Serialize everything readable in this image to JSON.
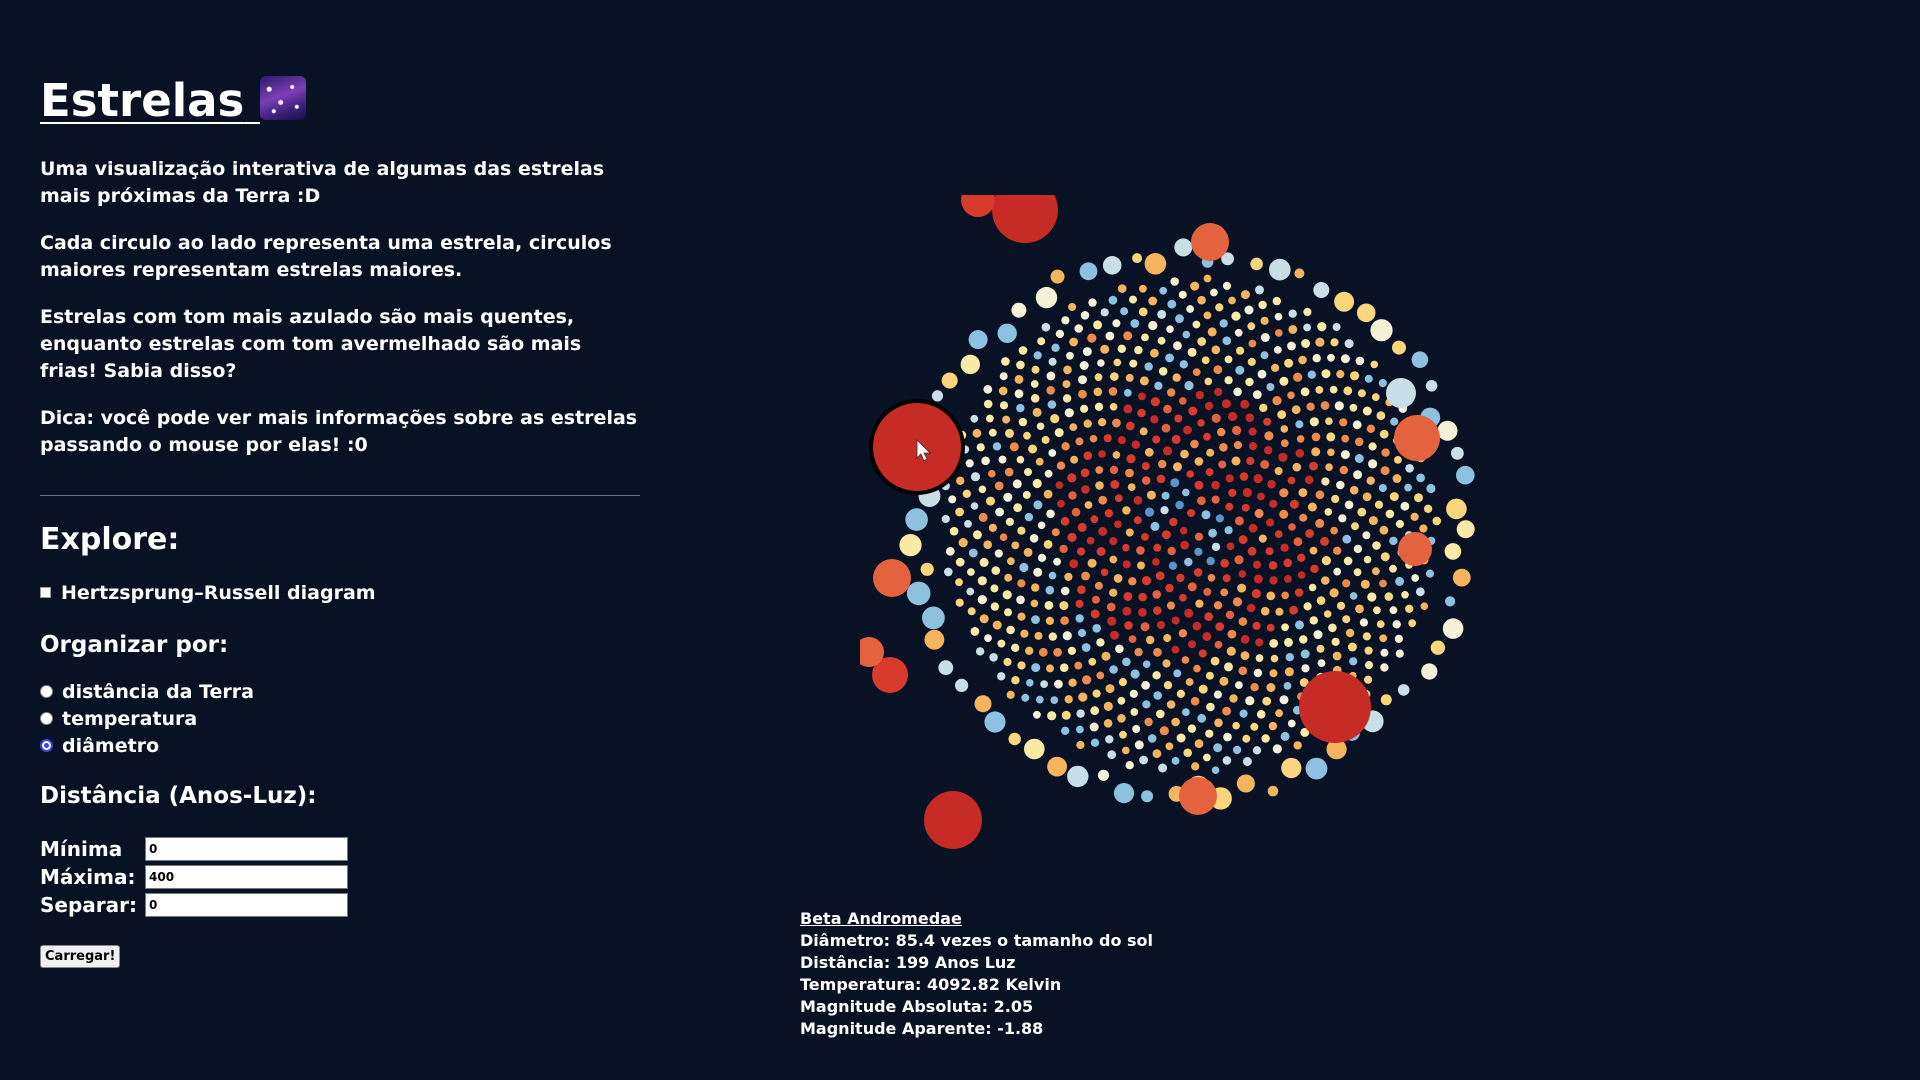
{
  "header": {
    "title": "Estrelas",
    "title_icon": "milky-way-icon"
  },
  "intro": {
    "p1": "Uma visualização interativa de algumas das estrelas mais próximas da Terra :D",
    "p2": "Cada circulo ao lado representa uma estrela, circulos maiores representam estrelas maiores.",
    "p3": "Estrelas com tom mais azulado são mais quentes, enquanto estrelas com tom avermelhado são mais frias! Sabia disso?",
    "p4": "Dica: você pode ver mais informações sobre as estrelas passando o mouse por elas! :0"
  },
  "explore": {
    "heading": "Explore:",
    "hr_label": "Hertzsprung–Russell diagram",
    "hr_checked": false
  },
  "organize": {
    "heading": "Organizar por:",
    "options": [
      "distância da Terra",
      "temperatura",
      "diâmetro"
    ],
    "selected": "diâmetro"
  },
  "distance": {
    "heading": "Distância (Anos-Luz):",
    "min_label": "Mínima",
    "min_value": "0",
    "max_label": "Máxima:",
    "max_value": "400",
    "sep_label": "Separar:",
    "sep_value": "0",
    "load_button": "Carregar!"
  },
  "tooltip": {
    "name": "Beta Andromedae",
    "diameter": "Diâmetro: 85.4 vezes o tamanho do sol",
    "distance": "Distância: 199 Anos Luz",
    "temperature": "Temperatura: 4092.82 Kelvin",
    "abs_mag": "Magnitude Absoluta: 2.05",
    "app_mag": "Magnitude Aparente: -1.88"
  },
  "colors": {
    "background": "#091124",
    "star_palette": [
      "#c62b26",
      "#d83a2c",
      "#e4633e",
      "#f08a4b",
      "#f7b45e",
      "#f9d57c",
      "#fbeaa6",
      "#f4f1d8",
      "#c8dfe8",
      "#8ec1df",
      "#5b95c8"
    ],
    "highlight_star": "#c62b26",
    "radio_accent": "#3344ee"
  },
  "visualization": {
    "star_count_approx": 960,
    "hovered_star": "Beta Andromedae"
  }
}
